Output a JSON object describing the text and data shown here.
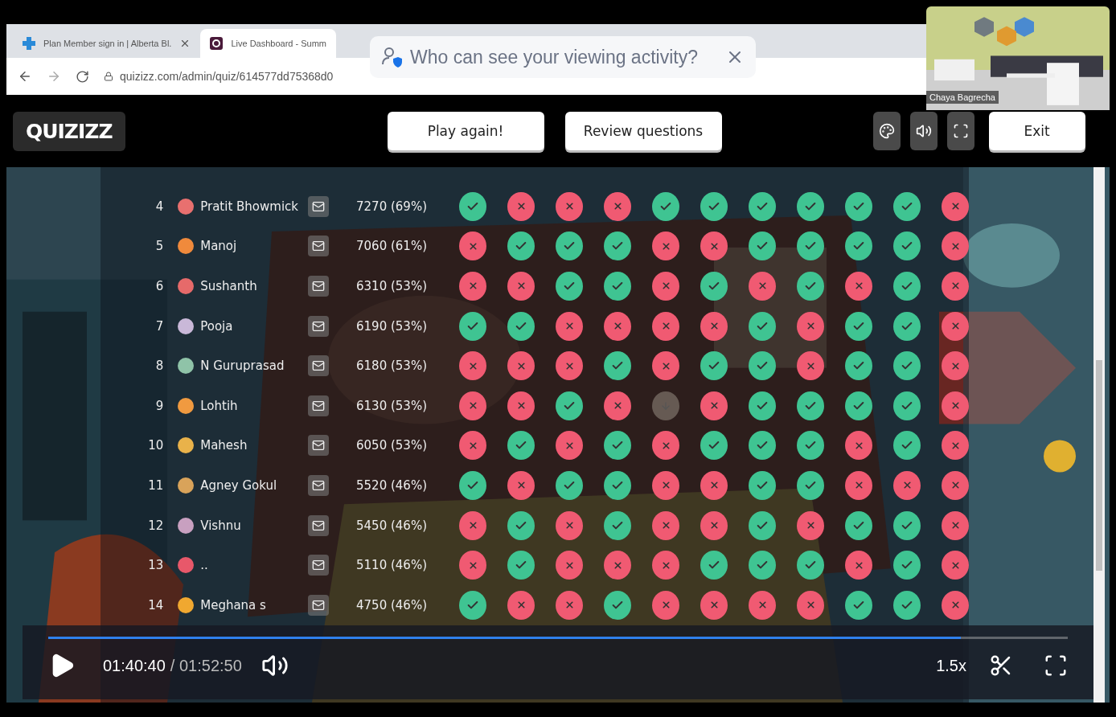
{
  "browser": {
    "tabs": [
      {
        "title": "Plan Member sign in | Alberta Bl.",
        "selected": false
      },
      {
        "title": "Live Dashboard - Summ",
        "selected": true
      }
    ],
    "url": "quizizz.com/admin/quiz/614577dd75368d0"
  },
  "privacy_popup": {
    "text": "Who can see your viewing activity?"
  },
  "webcam": {
    "name": "Chaya Bagrecha"
  },
  "app": {
    "logo": "QUIZIZZ",
    "buttons": [
      "Play again!",
      "Review questions"
    ],
    "exit": "Exit"
  },
  "leaderboard": [
    {
      "rank": "4",
      "name": "Pratit Bhowmick",
      "score": "7270 (69%)",
      "color": "#e8706f",
      "results": [
        {
          "kind": "correct"
        },
        {
          "kind": "wrong"
        },
        {
          "kind": "wrong"
        },
        {
          "kind": "wrong"
        },
        {
          "kind": "correct"
        },
        {
          "kind": "correct"
        },
        {
          "kind": "correct"
        },
        {
          "kind": "correct"
        },
        {
          "kind": "correct"
        },
        {
          "kind": "correct"
        },
        {
          "kind": "wrong"
        }
      ]
    },
    {
      "rank": "5",
      "name": "Manoj",
      "score": "7060 (61%)",
      "color": "#f08a3c",
      "results": [
        {
          "kind": "wrong"
        },
        {
          "kind": "correct"
        },
        {
          "kind": "correct"
        },
        {
          "kind": "correct"
        },
        {
          "kind": "wrong"
        },
        {
          "kind": "wrong"
        },
        {
          "kind": "correct"
        },
        {
          "kind": "correct"
        },
        {
          "kind": "correct"
        },
        {
          "kind": "correct"
        },
        {
          "kind": "wrong"
        }
      ]
    },
    {
      "rank": "6",
      "name": "Sushanth",
      "score": "6310 (53%)",
      "color": "#e66a6a",
      "results": [
        {
          "kind": "wrong"
        },
        {
          "kind": "wrong"
        },
        {
          "kind": "correct"
        },
        {
          "kind": "correct"
        },
        {
          "kind": "wrong"
        },
        {
          "kind": "correct"
        },
        {
          "kind": "wrong"
        },
        {
          "kind": "correct"
        },
        {
          "kind": "wrong"
        },
        {
          "kind": "correct"
        },
        {
          "kind": "wrong"
        }
      ]
    },
    {
      "rank": "7",
      "name": "Pooja",
      "score": "6190 (53%)",
      "color": "#c9b8d8",
      "results": [
        {
          "kind": "correct"
        },
        {
          "kind": "correct"
        },
        {
          "kind": "wrong"
        },
        {
          "kind": "wrong"
        },
        {
          "kind": "wrong"
        },
        {
          "kind": "wrong"
        },
        {
          "kind": "correct"
        },
        {
          "kind": "wrong"
        },
        {
          "kind": "correct"
        },
        {
          "kind": "correct"
        },
        {
          "kind": "wrong"
        }
      ]
    },
    {
      "rank": "8",
      "name": "N Guruprasad",
      "score": "6180 (53%)",
      "color": "#8fc3a8",
      "results": [
        {
          "kind": "wrong"
        },
        {
          "kind": "wrong"
        },
        {
          "kind": "wrong"
        },
        {
          "kind": "correct"
        },
        {
          "kind": "wrong"
        },
        {
          "kind": "correct"
        },
        {
          "kind": "correct"
        },
        {
          "kind": "wrong"
        },
        {
          "kind": "correct"
        },
        {
          "kind": "correct"
        },
        {
          "kind": "wrong"
        }
      ]
    },
    {
      "rank": "9",
      "name": "Lohtih",
      "score": "6130 (53%)",
      "color": "#f09a40",
      "results": [
        {
          "kind": "wrong"
        },
        {
          "kind": "wrong"
        },
        {
          "kind": "correct"
        },
        {
          "kind": "wrong"
        },
        {
          "kind": "skipped"
        },
        {
          "kind": "wrong"
        },
        {
          "kind": "correct"
        },
        {
          "kind": "correct"
        },
        {
          "kind": "correct"
        },
        {
          "kind": "correct"
        },
        {
          "kind": "wrong"
        }
      ]
    },
    {
      "rank": "10",
      "name": "Mahesh",
      "score": "6050 (53%)",
      "color": "#e9b24a",
      "results": [
        {
          "kind": "wrong"
        },
        {
          "kind": "correct"
        },
        {
          "kind": "wrong"
        },
        {
          "kind": "correct"
        },
        {
          "kind": "wrong"
        },
        {
          "kind": "correct"
        },
        {
          "kind": "correct"
        },
        {
          "kind": "correct"
        },
        {
          "kind": "wrong"
        },
        {
          "kind": "correct"
        },
        {
          "kind": "wrong"
        }
      ]
    },
    {
      "rank": "11",
      "name": "Agney Gokul",
      "score": "5520 (46%)",
      "color": "#d9a35a",
      "results": [
        {
          "kind": "correct"
        },
        {
          "kind": "wrong"
        },
        {
          "kind": "correct"
        },
        {
          "kind": "correct"
        },
        {
          "kind": "wrong"
        },
        {
          "kind": "wrong"
        },
        {
          "kind": "correct"
        },
        {
          "kind": "correct"
        },
        {
          "kind": "wrong"
        },
        {
          "kind": "wrong"
        },
        {
          "kind": "wrong"
        }
      ]
    },
    {
      "rank": "12",
      "name": "Vishnu",
      "score": "5450 (46%)",
      "color": "#c8a0c0",
      "results": [
        {
          "kind": "wrong"
        },
        {
          "kind": "correct"
        },
        {
          "kind": "wrong"
        },
        {
          "kind": "correct"
        },
        {
          "kind": "wrong"
        },
        {
          "kind": "wrong"
        },
        {
          "kind": "correct"
        },
        {
          "kind": "wrong"
        },
        {
          "kind": "correct"
        },
        {
          "kind": "correct"
        },
        {
          "kind": "wrong"
        }
      ]
    },
    {
      "rank": "13",
      "name": "..",
      "score": "5110 (46%)",
      "color": "#e8586a",
      "results": [
        {
          "kind": "wrong"
        },
        {
          "kind": "correct"
        },
        {
          "kind": "wrong"
        },
        {
          "kind": "wrong"
        },
        {
          "kind": "wrong"
        },
        {
          "kind": "correct"
        },
        {
          "kind": "correct"
        },
        {
          "kind": "correct"
        },
        {
          "kind": "wrong"
        },
        {
          "kind": "correct"
        },
        {
          "kind": "wrong"
        }
      ]
    },
    {
      "rank": "14",
      "name": "Meghana s",
      "score": "4750 (46%)",
      "color": "#f0a830",
      "results": [
        {
          "kind": "correct"
        },
        {
          "kind": "wrong"
        },
        {
          "kind": "wrong"
        },
        {
          "kind": "correct"
        },
        {
          "kind": "wrong"
        },
        {
          "kind": "wrong"
        },
        {
          "kind": "wrong"
        },
        {
          "kind": "wrong"
        },
        {
          "kind": "correct"
        },
        {
          "kind": "correct"
        },
        {
          "kind": "wrong"
        }
      ]
    }
  ],
  "player": {
    "time": "01:40:40",
    "duration": "/ 01:52:50",
    "speed": "1.5x",
    "progress": {
      "level": 0.895
    }
  }
}
